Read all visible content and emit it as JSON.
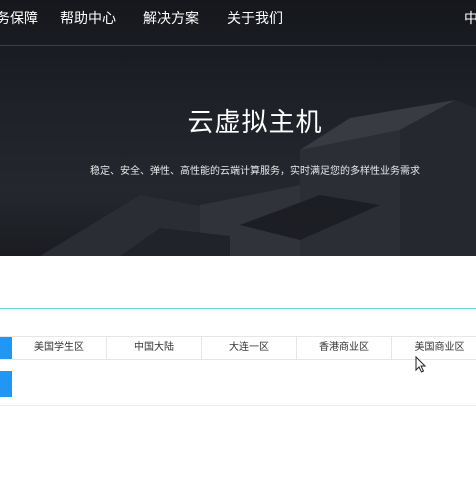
{
  "nav": {
    "items": [
      {
        "label": "务保障"
      },
      {
        "label": "帮助中心"
      },
      {
        "label": "解决方案"
      },
      {
        "label": "关于我们"
      },
      {
        "label": "中"
      }
    ]
  },
  "hero": {
    "title": "云虚拟主机",
    "subtitle": "稳定、安全、弹性、高性能的云端计算服务，实时满足您的多样性业务需求"
  },
  "regions": {
    "tabs": [
      {
        "label": "美国学生区"
      },
      {
        "label": "中国大陆"
      },
      {
        "label": "大连一区"
      },
      {
        "label": "香港商业区"
      },
      {
        "label": "美国商业区"
      }
    ]
  },
  "colors": {
    "accent": "#2196f3",
    "divider_teal": "#6fd3d1",
    "hero_bg": "#1f2228"
  }
}
